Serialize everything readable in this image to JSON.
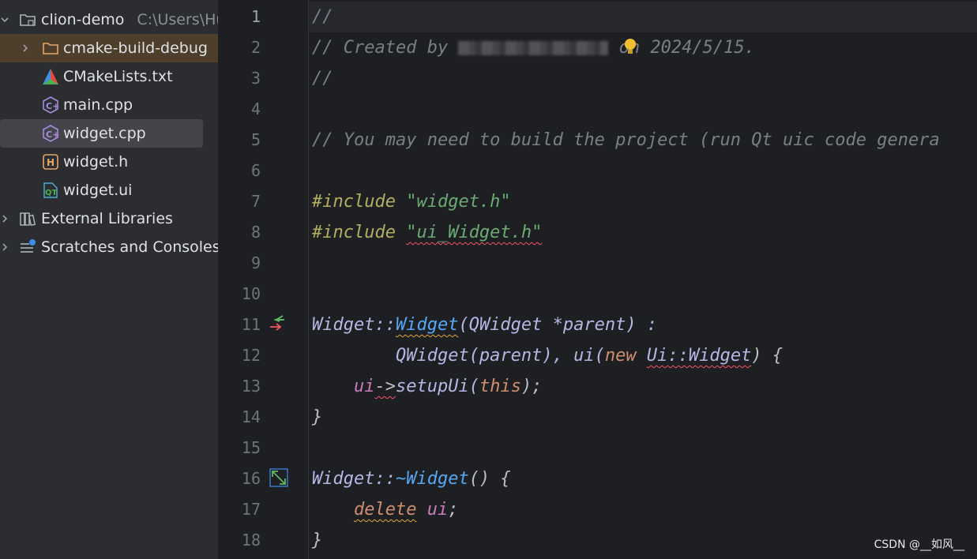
{
  "tree": {
    "root": {
      "label": "clion-demo",
      "path": "C:\\Users\\Hu"
    },
    "items": [
      {
        "label": "cmake-build-debug",
        "icon": "folder-icon"
      },
      {
        "label": "CMakeLists.txt",
        "icon": "cmake-icon"
      },
      {
        "label": "main.cpp",
        "icon": "cpp-file-icon"
      },
      {
        "label": "widget.cpp",
        "icon": "cpp-file-icon"
      },
      {
        "label": "widget.h",
        "icon": "header-file-icon"
      },
      {
        "label": "widget.ui",
        "icon": "qt-ui-file-icon"
      },
      {
        "label": "External Libraries",
        "icon": "library-icon"
      },
      {
        "label": "Scratches and Consoles",
        "icon": "scratches-icon"
      }
    ]
  },
  "editor": {
    "line_numbers": [
      "1",
      "2",
      "3",
      "4",
      "5",
      "6",
      "7",
      "8",
      "9",
      "10",
      "11",
      "12",
      "13",
      "14",
      "15",
      "16",
      "17",
      "18"
    ],
    "current_line": 1,
    "code": {
      "l1": "//",
      "l2_pre": "// Created by ",
      "l2_post": " on 2024/5/15.",
      "l3": "//",
      "l5": "// You may need to build the project (run Qt uic code genera",
      "l7_kw": "#include",
      "l7_str": "\"widget.h\"",
      "l8_kw": "#include",
      "l8_str": "\"ui_Widget.h\"",
      "l11_a": "Widget::",
      "l11_b": "Widget",
      "l11_c": "(QWidget *parent) :",
      "l12_a": "QWidget(parent), ui(",
      "l12_new": "new",
      "l12_ns": "Ui::Widget",
      "l12_b": ") {",
      "l13_ui": "ui",
      "l13_arrow": "->",
      "l13_fn": "setupUi(",
      "l13_this": "this",
      "l13_end": ");",
      "l14": "}",
      "l16_a": "Widget::",
      "l16_b": "~Widget",
      "l16_c": "() {",
      "l17_del": "delete",
      "l17_ui": "ui",
      "l17_end": ";",
      "l18": "}"
    }
  },
  "watermark": "CSDN @__如风__",
  "colors": {
    "comment": "#7a7e85",
    "preprocessor": "#b3ae60",
    "string": "#6aab73",
    "function": "#56a8f5",
    "keyword": "#cf8e6d",
    "member": "#c77dbb",
    "tree_selected_dir": "#4e3f2c",
    "tree_selected_file": "#43454a"
  }
}
